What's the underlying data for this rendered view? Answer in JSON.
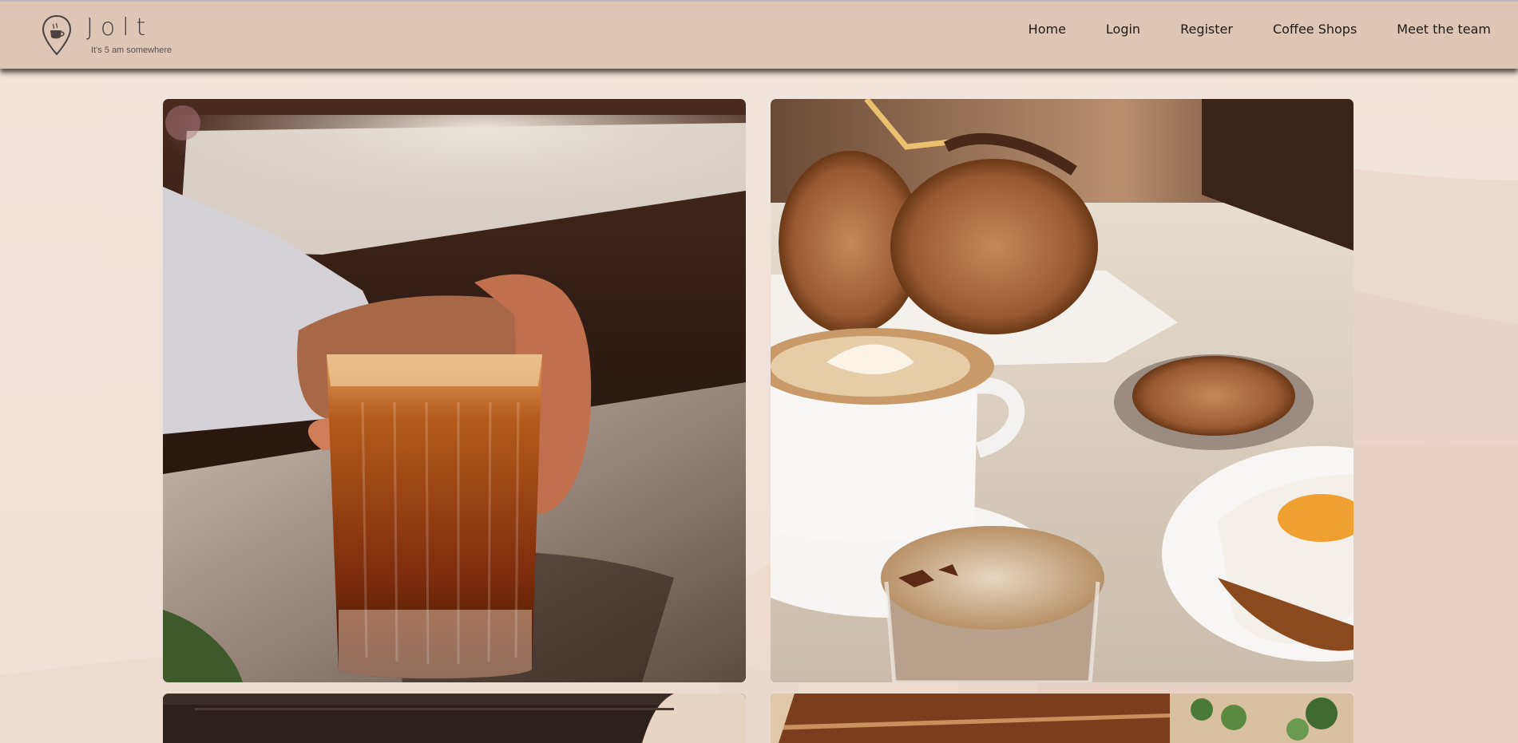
{
  "brand": {
    "name": "Jolt",
    "tagline": "It's 5 am somewhere",
    "logo_icon": "coffee-pin-icon"
  },
  "nav": {
    "items": [
      {
        "label": "Home"
      },
      {
        "label": "Login"
      },
      {
        "label": "Register"
      },
      {
        "label": "Coffee Shops"
      },
      {
        "label": "Meet the team"
      }
    ]
  },
  "gallery": {
    "images": [
      {
        "alt": "iced-coffee-photo"
      },
      {
        "alt": "latte-and-pastries-photo"
      },
      {
        "alt": "coffee-bar-photo"
      },
      {
        "alt": "cafe-interior-photo"
      }
    ]
  },
  "colors": {
    "header": "#dfc6b4",
    "page_background": "#f1e4dc",
    "nav_text": "#1f1a17"
  }
}
